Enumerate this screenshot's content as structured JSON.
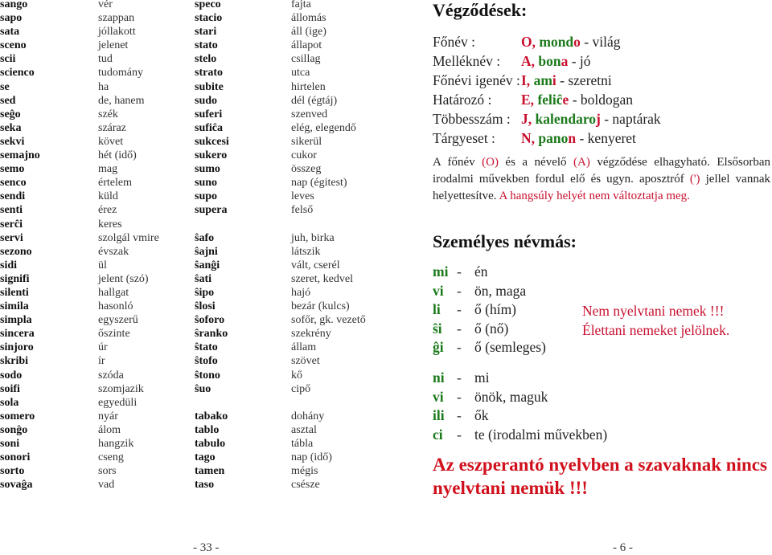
{
  "left_page": {
    "column1": [
      {
        "eo": "sango",
        "hu": "vér"
      },
      {
        "eo": "sapo",
        "hu": "szappan"
      },
      {
        "eo": "sata",
        "hu": "jóllakott"
      },
      {
        "eo": "sceno",
        "hu": "jelenet"
      },
      {
        "eo": "scii",
        "hu": "tud"
      },
      {
        "eo": "scienco",
        "hu": "tudomány"
      },
      {
        "eo": "se",
        "hu": "ha"
      },
      {
        "eo": "sed",
        "hu": "de, hanem"
      },
      {
        "eo": "seĝo",
        "hu": "szék"
      },
      {
        "eo": "seka",
        "hu": "száraz"
      },
      {
        "eo": "sekvi",
        "hu": "követ"
      },
      {
        "eo": "semajno",
        "hu": "hét (idő)"
      },
      {
        "eo": "semo",
        "hu": "mag"
      },
      {
        "eo": "senco",
        "hu": "értelem"
      },
      {
        "eo": "sendi",
        "hu": "küld"
      },
      {
        "eo": "senti",
        "hu": "érez"
      },
      {
        "eo": "serĉi",
        "hu": "keres"
      },
      {
        "eo": "servi",
        "hu": "szolgál vmire"
      },
      {
        "eo": "sezono",
        "hu": "évszak"
      },
      {
        "eo": "sidi",
        "hu": "ül"
      },
      {
        "eo": "signifi",
        "hu": "jelent (szó)"
      },
      {
        "eo": "silenti",
        "hu": "hallgat"
      },
      {
        "eo": "simila",
        "hu": "hasonló"
      },
      {
        "eo": "simpla",
        "hu": "egyszerű"
      },
      {
        "eo": "sincera",
        "hu": "őszinte"
      },
      {
        "eo": "sinjoro",
        "hu": "úr"
      },
      {
        "eo": "skribi",
        "hu": "ír"
      },
      {
        "eo": "sodo",
        "hu": "szóda"
      },
      {
        "eo": "soifi",
        "hu": "szomjazik"
      },
      {
        "eo": "sola",
        "hu": "egyedüli"
      },
      {
        "eo": "somero",
        "hu": "nyár"
      },
      {
        "eo": "sonĝo",
        "hu": "álom"
      },
      {
        "eo": "soni",
        "hu": "hangzik"
      },
      {
        "eo": "sonori",
        "hu": "cseng"
      },
      {
        "eo": "sorto",
        "hu": "sors"
      },
      {
        "eo": "sovaĝa",
        "hu": "vad"
      }
    ],
    "column2": [
      {
        "eo": "speco",
        "hu": "fajta"
      },
      {
        "eo": "stacio",
        "hu": "állomás"
      },
      {
        "eo": "stari",
        "hu": "áll   (ige)"
      },
      {
        "eo": "stato",
        "hu": "állapot"
      },
      {
        "eo": "stelo",
        "hu": "csillag"
      },
      {
        "eo": "strato",
        "hu": "utca"
      },
      {
        "eo": "subite",
        "hu": "hirtelen"
      },
      {
        "eo": "sudo",
        "hu": "dél (égtáj)"
      },
      {
        "eo": "suferi",
        "hu": "szenved"
      },
      {
        "eo": "sufiĉa",
        "hu": "elég, elegendő"
      },
      {
        "eo": "sukcesi",
        "hu": "sikerül"
      },
      {
        "eo": "sukero",
        "hu": "cukor"
      },
      {
        "eo": "sumo",
        "hu": "összeg"
      },
      {
        "eo": "suno",
        "hu": "nap (égitest)"
      },
      {
        "eo": "supo",
        "hu": "leves"
      },
      {
        "eo": "supera",
        "hu": "felső"
      },
      {
        "eo": "",
        "hu": ""
      },
      {
        "eo": "ŝafo",
        "hu": "juh, birka"
      },
      {
        "eo": "ŝajni",
        "hu": "látszik"
      },
      {
        "eo": "ŝanĝi",
        "hu": "vált, cserél"
      },
      {
        "eo": "ŝati",
        "hu": "szeret, kedvel"
      },
      {
        "eo": "ŝipo",
        "hu": "hajó"
      },
      {
        "eo": "ŝlosi",
        "hu": "bezár (kulcs)"
      },
      {
        "eo": "ŝoforo",
        "hu": "sofőr, gk. vezető"
      },
      {
        "eo": "ŝranko",
        "hu": "szekrény"
      },
      {
        "eo": "ŝtato",
        "hu": "állam"
      },
      {
        "eo": "ŝtofo",
        "hu": "szövet"
      },
      {
        "eo": "ŝtono",
        "hu": "kő"
      },
      {
        "eo": "ŝuo",
        "hu": "cipő"
      },
      {
        "eo": "",
        "hu": ""
      },
      {
        "eo": "tabako",
        "hu": "dohány"
      },
      {
        "eo": "tablo",
        "hu": "asztal"
      },
      {
        "eo": "tabulo",
        "hu": "tábla"
      },
      {
        "eo": "tago",
        "hu": "nap (idő)"
      },
      {
        "eo": "tamen",
        "hu": "mégis"
      },
      {
        "eo": "taso",
        "hu": "csésze"
      }
    ],
    "page_number": "- 33 -"
  },
  "right_page": {
    "endings_title": "Végződések:",
    "endings": [
      {
        "label": "Főnév :",
        "ending": "O,",
        "stem": "mond",
        "suffix": "o",
        "meaning": "-  világ"
      },
      {
        "label": "Melléknév :",
        "ending": "A,",
        "stem": "bon",
        "suffix": "a",
        "meaning": "-  jó"
      },
      {
        "label": "Főnévi igenév :",
        "ending": "I,",
        "stem": "am",
        "suffix": "i",
        "meaning": "-  szeretni"
      },
      {
        "label": "Határozó :",
        "ending": "E,",
        "stem": "feliĉ",
        "suffix": "e",
        "meaning": "-  boldogan"
      },
      {
        "label": "Többesszám :",
        "ending": "J,",
        "stem": "kalendaro",
        "suffix": "j",
        "meaning": "-  naptárak"
      },
      {
        "label": "Tárgyeset :",
        "ending": "N,",
        "stem": "pano",
        "suffix": "n",
        "meaning": "-  kenyeret"
      }
    ],
    "note": {
      "part1": "A főnév ",
      "o": "(O)",
      "part2": "  és a névelő  ",
      "a": "(A)",
      "part3": "  végződése elhagyható. Elsősorban irodalmi művekben fordul elő és ugyn. aposztróf ",
      "apos": "(')",
      "part4": " jellel vannak helyettesítve. ",
      "red_tail": "A hangsúly helyét nem változtatja meg."
    },
    "pronouns_title": "Személyes névmás:",
    "pronouns_singular": [
      {
        "eo": "mi",
        "hu": "én"
      },
      {
        "eo": "vi",
        "hu": "ön, maga"
      },
      {
        "eo": "li",
        "hu": "ő (hím)"
      },
      {
        "eo": "ŝi",
        "hu": "ő (nő)"
      },
      {
        "eo": "ĝi",
        "hu": "ő (semleges)"
      }
    ],
    "pronouns_plural": [
      {
        "eo": "ni",
        "hu": "mi"
      },
      {
        "eo": "vi",
        "hu": "önök, maguk"
      },
      {
        "eo": "ili",
        "hu": "ők"
      },
      {
        "eo": "ci",
        "hu": "te   (irodalmi művekben)"
      }
    ],
    "dash": "-",
    "side_note_1": "Nem nyelvtani nemek  !!!",
    "side_note_2": "Élettani nemeket jelölnek.",
    "final_statement": "Az eszperantó nyelvben a szavaknak nincs nyelvtani nemük !!!",
    "page_number": "- 6 -"
  },
  "colors": {
    "accent_red": "#c8102e",
    "accent_green": "#1b7a1b",
    "text": "#1a1a1a"
  }
}
